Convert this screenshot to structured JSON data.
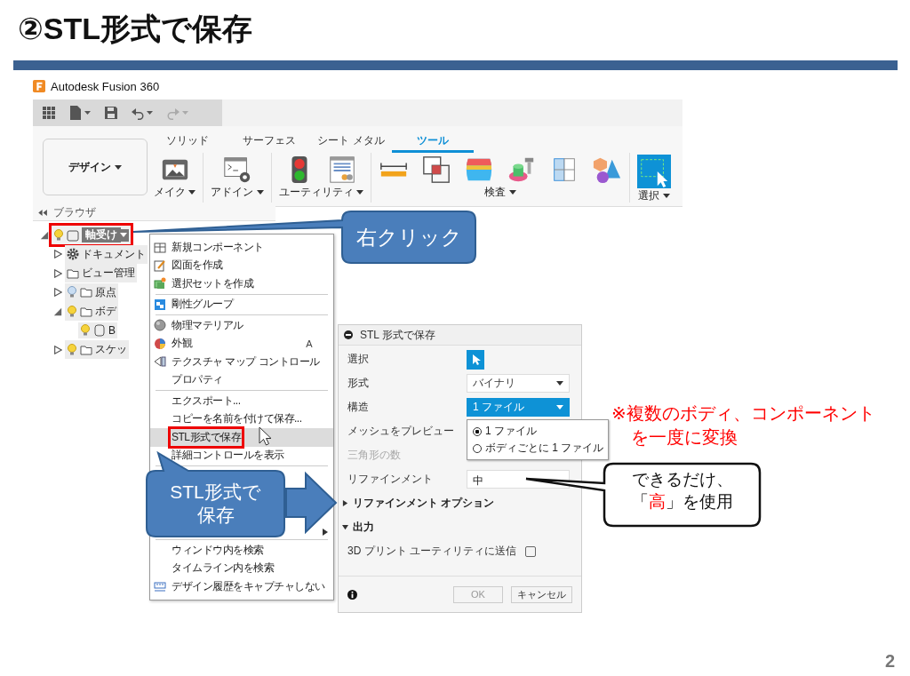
{
  "slide": {
    "title": "②STL形式で保存",
    "page_number": "2"
  },
  "app": {
    "title": "Autodesk Fusion 360"
  },
  "ribbon": {
    "workspace": "デザイン",
    "tabs": [
      {
        "label": "ソリッド",
        "selected": false
      },
      {
        "label": "サーフェス",
        "selected": false
      },
      {
        "label": "シート メタル",
        "selected": false
      },
      {
        "label": "ツール",
        "selected": true
      }
    ],
    "groups": [
      {
        "label": "メイク"
      },
      {
        "label": "アドイン"
      },
      {
        "label": "ユーティリティ"
      },
      {
        "label": "検査"
      },
      {
        "label": "選択"
      }
    ]
  },
  "browser": {
    "title": "ブラウザ",
    "tree": [
      {
        "label": "軸受け",
        "kind": "component",
        "visible": true,
        "expanded": true,
        "selected": true,
        "children": [
          {
            "label": "ドキュメント",
            "kind": "settings",
            "expanded": false
          },
          {
            "label": "ビュー管理",
            "kind": "folder",
            "expanded": false
          },
          {
            "label": "原点",
            "kind": "folder",
            "visible": false,
            "expanded": false
          },
          {
            "label": "ボデ",
            "kind": "folder",
            "visible": true,
            "expanded": true,
            "children": [
              {
                "label": "B",
                "kind": "body",
                "visible": true
              }
            ]
          },
          {
            "label": "スケッ",
            "kind": "folder",
            "visible": true,
            "expanded": false
          }
        ]
      }
    ]
  },
  "context_menu": {
    "items": [
      {
        "label": "新規コンポーネント",
        "selected": false,
        "separator_after": false
      },
      {
        "label": "図面を作成",
        "selected": false,
        "separator_after": false
      },
      {
        "label": "選択セットを作成",
        "selected": false,
        "separator_after": true
      },
      {
        "label": "剛性グループ",
        "selected": false,
        "separator_after": true
      },
      {
        "label": "物理マテリアル",
        "selected": false,
        "separator_after": false
      },
      {
        "label": "外観",
        "shortcut": "A",
        "selected": false,
        "separator_after": false
      },
      {
        "label": "テクスチャ マップ コントロール",
        "selected": false,
        "separator_after": false
      },
      {
        "label": "プロパティ",
        "selected": false,
        "separator_after": true
      },
      {
        "label": "エクスポート...",
        "selected": false,
        "separator_after": false
      },
      {
        "label": "コピーを名前を付けて保存...",
        "selected": false,
        "separator_after": false
      },
      {
        "label": "STL形式で保存",
        "selected": true,
        "separator_after": false
      },
      {
        "label": "詳細コントロールを表示",
        "selected": false,
        "separator_after": true
      }
    ],
    "bottom_items": [
      {
        "label": "ウィンドウ内を検索",
        "selected": false
      },
      {
        "label": "タイムライン内を検索",
        "selected": false
      },
      {
        "label": "デザイン履歴をキャプチャしない",
        "selected": false
      }
    ]
  },
  "dialog": {
    "title": "STL 形式で保存",
    "rows": [
      {
        "kind": "selection",
        "label": "選択"
      },
      {
        "kind": "select",
        "label": "形式",
        "value": "バイナリ",
        "open": false
      },
      {
        "kind": "select",
        "label": "構造",
        "value": "1 ファイル",
        "open": true
      },
      {
        "kind": "label",
        "label": "メッシュをプレビュー",
        "disabled": false
      },
      {
        "kind": "label",
        "label": "三角形の数",
        "disabled": true
      },
      {
        "kind": "text",
        "label": "リファインメント",
        "value": "中"
      },
      {
        "kind": "section",
        "label": "リファインメント オプション",
        "expanded": false
      },
      {
        "kind": "section",
        "label": "出力",
        "expanded": true
      },
      {
        "kind": "checkbox",
        "label": "3D プリント ユーティリティに送信",
        "checked": false
      }
    ],
    "dropdown_options": [
      {
        "label": "1 ファイル",
        "selected": true
      },
      {
        "label": "ボディごとに 1 ファイル",
        "selected": false
      }
    ],
    "buttons": [
      {
        "label": "OK",
        "disabled": true
      },
      {
        "label": "キャンセル",
        "disabled": false
      }
    ]
  },
  "annotations": {
    "callouts": [
      [
        "右クリック"
      ],
      [
        "STL形式で",
        "保存"
      ]
    ],
    "note": [
      "※複数のボディ、コンポーネント",
      "を一度に変換"
    ],
    "speech": [
      [
        {
          "text": "できるだけ、",
          "emphasis": false
        }
      ],
      [
        {
          "text": "「",
          "emphasis": false
        },
        {
          "text": "高",
          "emphasis": true
        },
        {
          "text": "」を使用",
          "emphasis": false
        }
      ]
    ]
  }
}
